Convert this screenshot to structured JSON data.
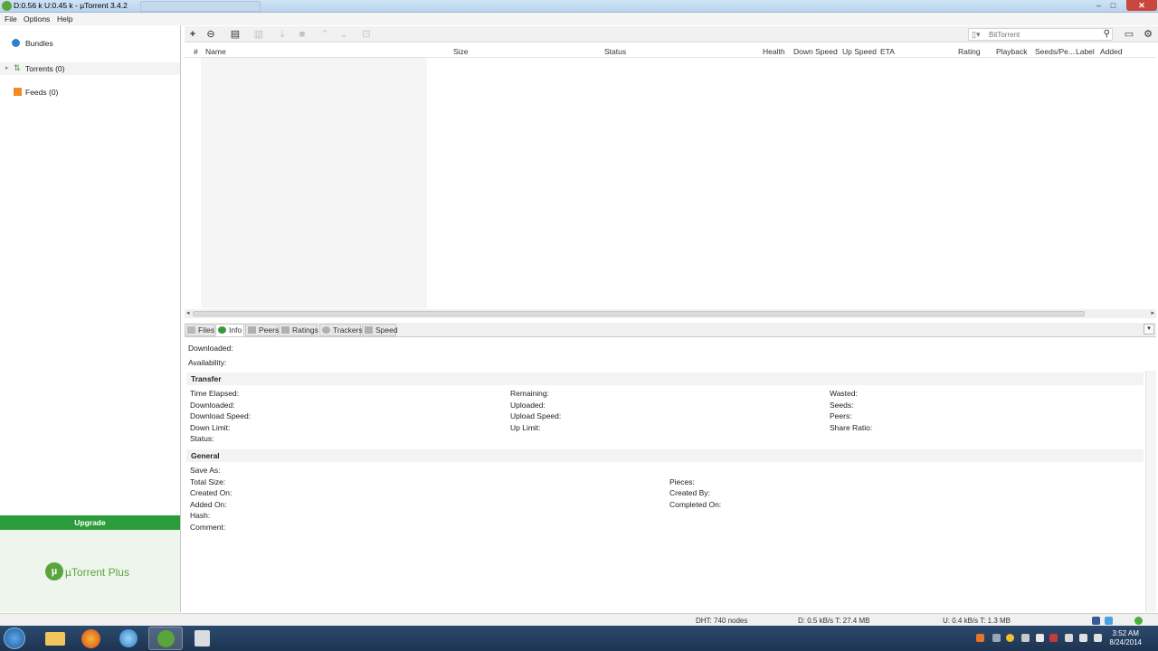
{
  "window": {
    "title": "D:0.56 k U:0.45 k - µTorrent 3.4.2",
    "controls": [
      "minimize",
      "maximize",
      "close"
    ]
  },
  "menu": [
    "File",
    "Options",
    "Help"
  ],
  "sidebar": {
    "bundles": "Bundles",
    "torrents": "Torrents (0)",
    "feeds": "Feeds (0)",
    "upgrade": "Upgrade",
    "promo_logo_mark": "µ",
    "promo_logo_text": "µTorrent Plus"
  },
  "toolbar": {
    "icons": [
      "add-torrent-icon",
      "add-url-icon",
      "create-torrent-icon",
      "remove-icon",
      "start-icon",
      "stop-icon",
      "move-up-icon",
      "move-down-icon",
      "unlock-icon",
      "remote-icon",
      "settings-icon"
    ],
    "search_placeholder": "BitTorrent"
  },
  "columns": [
    "#",
    "Name",
    "Size",
    "Status",
    "Health",
    "Down Speed",
    "Up Speed",
    "ETA",
    "Rating",
    "Playback",
    "Seeds/Pe...",
    "Label",
    "Added"
  ],
  "tabs": [
    "Files",
    "Info",
    "Peers",
    "Ratings",
    "Trackers",
    "Speed"
  ],
  "active_tab": "Info",
  "info": {
    "downloaded": "Downloaded:",
    "availability": "Availability:",
    "transfer_title": "Transfer",
    "transfer": {
      "col1": [
        "Time Elapsed:",
        "Downloaded:",
        "Download Speed:",
        "Down Limit:",
        "Status:"
      ],
      "col2": [
        "Remaining:",
        "Uploaded:",
        "Upload Speed:",
        "Up Limit:"
      ],
      "col3": [
        "Wasted:",
        "Seeds:",
        "Peers:",
        "Share Ratio:"
      ]
    },
    "general_title": "General",
    "general": {
      "col1": [
        "Save As:",
        "Total Size:",
        "Created On:",
        "Added On:",
        "Hash:",
        "Comment:"
      ],
      "col2": [
        "Pieces:",
        "Created By:",
        "Completed On:"
      ]
    }
  },
  "status": {
    "dht": "DHT: 740 nodes",
    "down": "D: 0.5 kB/s T: 27.4 MB",
    "up": "U: 0.4 kB/s T: 1.3 MB"
  },
  "taskbar": {
    "apps": [
      "start-button",
      "file-explorer",
      "firefox",
      "itunes",
      "utorrent",
      "calculator"
    ],
    "time": "3:52 AM",
    "date": "8/24/2014"
  },
  "colors": {
    "utorrent_green": "#5aa53b",
    "upgrade_bg": "#2b9c3b",
    "taskbar_bg": "#1d3452"
  }
}
